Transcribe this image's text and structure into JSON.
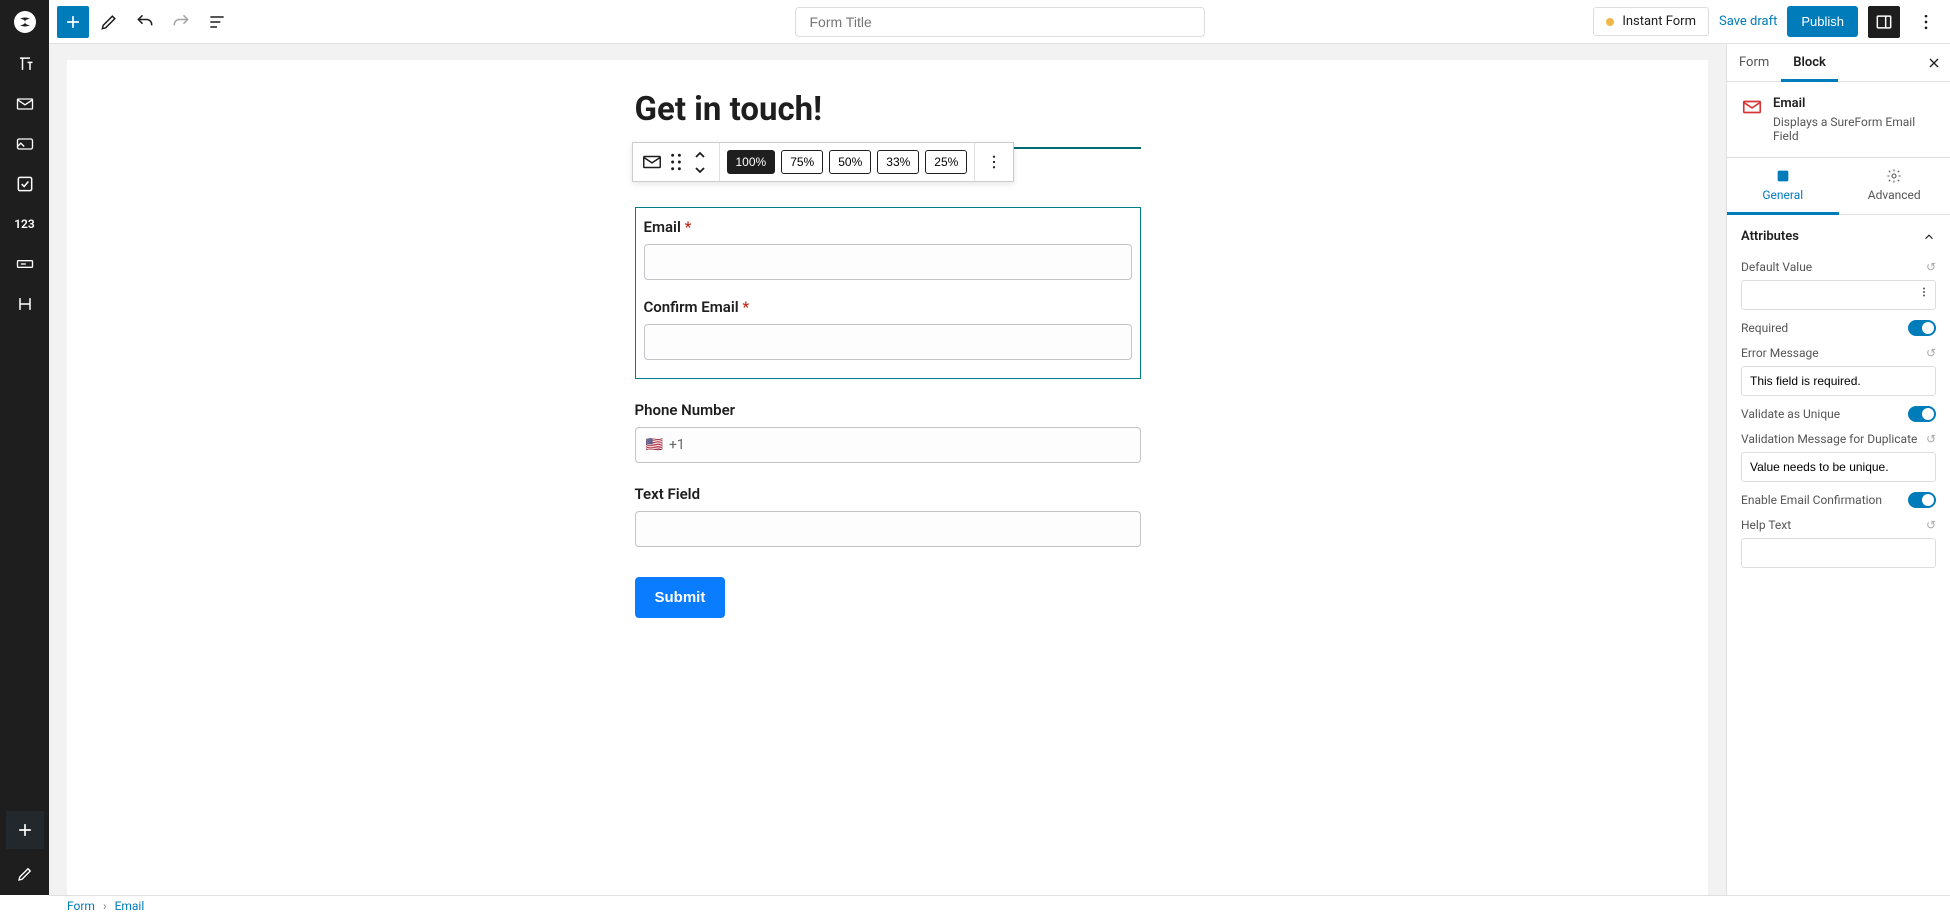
{
  "topbar": {
    "form_title_placeholder": "Form Title",
    "instant_form_label": "Instant Form",
    "save_draft_label": "Save draft",
    "publish_label": "Publish"
  },
  "left_rail": {
    "items": [
      "logo",
      "text",
      "email",
      "card",
      "checkbox",
      "number",
      "slider",
      "heading"
    ],
    "number_label": "123"
  },
  "block_toolbar": {
    "widths": [
      "100%",
      "75%",
      "50%",
      "33%",
      "25%"
    ],
    "active_width": "100%"
  },
  "form": {
    "heading": "Get in touch!",
    "email_label": "Email",
    "confirm_email_label": "Confirm Email",
    "phone_label": "Phone Number",
    "phone_prefix": "+1",
    "phone_flag": "🇺🇸",
    "text_field_label": "Text Field",
    "submit_label": "Submit"
  },
  "sidebar": {
    "tabs": {
      "form": "Form",
      "block": "Block"
    },
    "block_header": {
      "title": "Email",
      "description": "Displays a SureForm Email Field"
    },
    "subtabs": {
      "general": "General",
      "advanced": "Advanced"
    },
    "attributes_section_title": "Attributes",
    "attrs": {
      "default_value_label": "Default Value",
      "default_value": "",
      "required_label": "Required",
      "error_message_label": "Error Message",
      "error_message": "This field is required.",
      "validate_unique_label": "Validate as Unique",
      "validation_dup_label": "Validation Message for Duplicate",
      "validation_dup_message": "Value needs to be unique.",
      "enable_confirmation_label": "Enable Email Confirmation",
      "help_text_label": "Help Text",
      "help_text": ""
    }
  },
  "breadcrumb": {
    "root": "Form",
    "current": "Email"
  }
}
